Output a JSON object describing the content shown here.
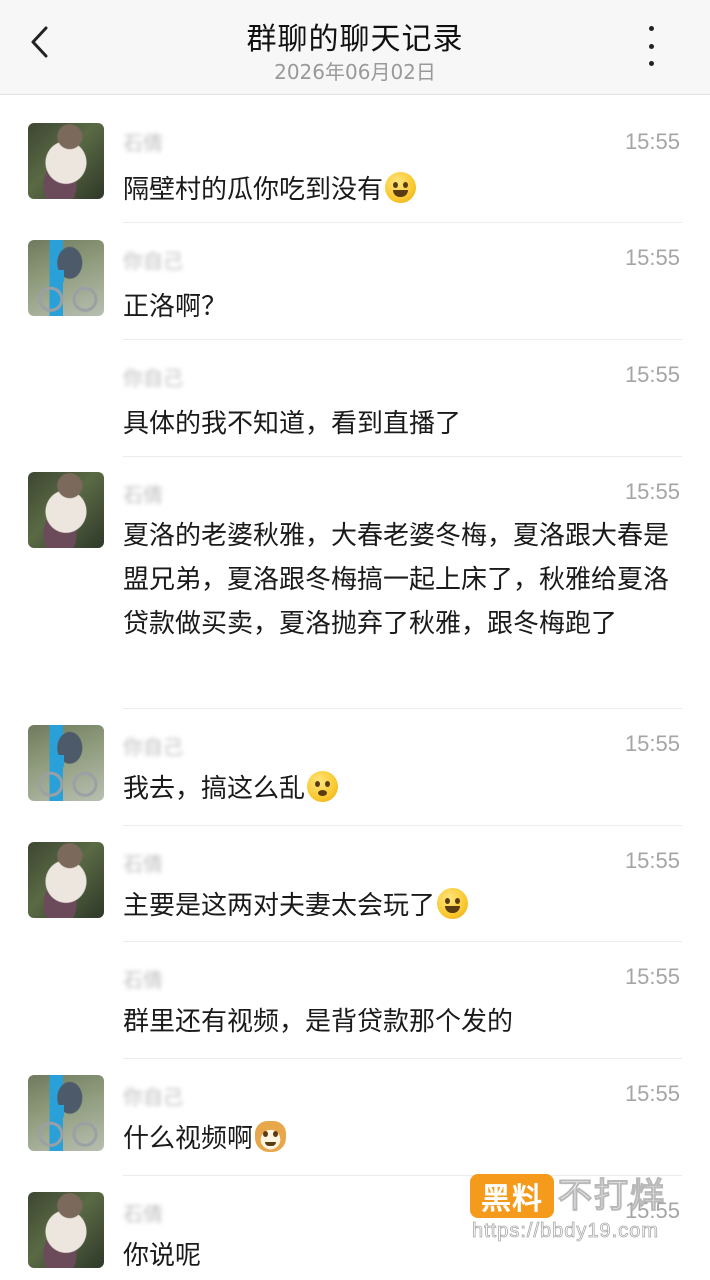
{
  "header": {
    "title": "群聊的聊天记录",
    "date": "2026年06月02日"
  },
  "messages": [
    {
      "sender": "石倩",
      "time": "15:55",
      "text": "隔壁村的瓜你吃到没有",
      "emoji": "drooling-face-icon",
      "avatar": "woman-with-flowers"
    },
    {
      "sender": "你自己",
      "time": "15:55",
      "text": "正洛啊？",
      "avatar": "person-on-bicycle"
    },
    {
      "sender": "你自己",
      "time": "15:55",
      "text": "具体的我不知道，看到直播了"
    },
    {
      "sender": "石倩",
      "time": "15:55",
      "text": "夏洛的老婆秋雅，大春老婆冬梅，夏洛跟大春是盟兄弟，夏洛跟冬梅搞一起上床了，秋雅给夏洛贷款做买卖，夏洛抛弃了秋雅，跟冬梅跑了",
      "avatar": "woman-with-flowers"
    },
    {
      "sender": "你自己",
      "time": "15:55",
      "text": "我去，搞这么乱",
      "emoji": "flushed-face-icon",
      "avatar": "person-on-bicycle"
    },
    {
      "sender": "石倩",
      "time": "15:55",
      "text": "主要是这两对夫妻太会玩了",
      "emoji": "grinning-face-icon",
      "avatar": "woman-with-flowers"
    },
    {
      "sender": "石倩",
      "time": "15:55",
      "text": "群里还有视频，是背贷款那个发的"
    },
    {
      "sender": "你自己",
      "time": "15:55",
      "text": "什么视频啊",
      "emoji": "doge-icon",
      "avatar": "person-on-bicycle"
    },
    {
      "sender": "石倩",
      "time": "15:55",
      "text": "你说呢",
      "avatar": "woman-with-flowers"
    }
  ],
  "watermark": {
    "badge": "黑料",
    "text": "不打烊",
    "url": "https://bbdy19.com"
  },
  "colors": {
    "header_bg": "#f7f7f7",
    "time_text": "#a5a5a5",
    "watermark_orange": "#f59a1b"
  }
}
